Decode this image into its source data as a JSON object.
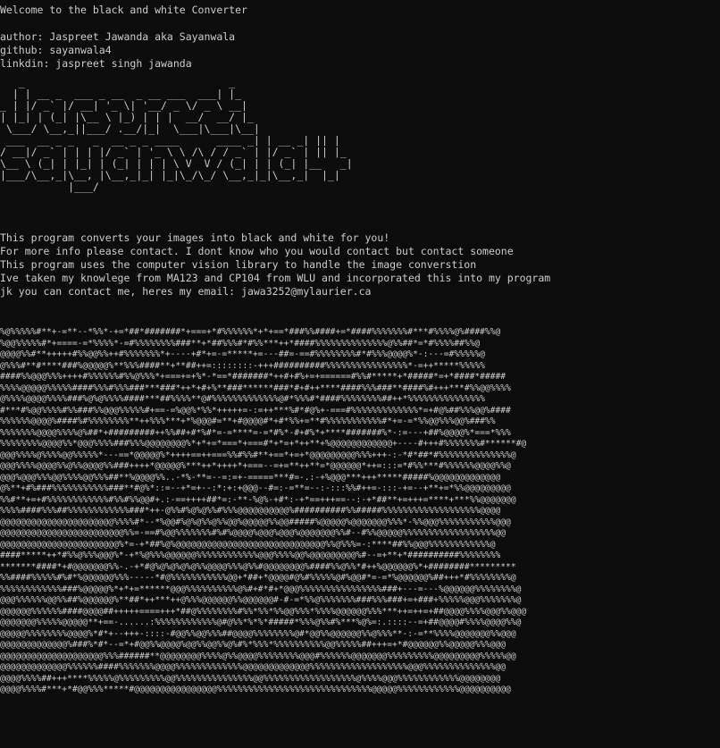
{
  "terminal": {
    "welcome": "Welcome to the black and white Converter",
    "author": "author: Jaspreet Jawanda aka Sayanwala",
    "github": "github: sayanwala4",
    "linkedin": "linkdin: jaspreet singh jawanda"
  },
  "banner": {
    "name1": "Jaspreet",
    "name2": "sayanwala4",
    "lines": [
      "   _                                 _",
      "  | | __ _  ___ _ __  _ __ ___  ___| |_",
      "_ | |/ _` |/ __| '_ \\| '__/ _ \\/ _ \\ __|",
      "| |_| | (_| |\\__ \\ |_) | | |  __/  __/ |_",
      " \\___/ \\__,_||___/ .__/|_|  \\___|\\___|\\__|",
      " ___  __ _ _   _  __ _ _ ____      ____ _| | __ _| || |",
      "/ __|/ _` | | | |/ _` | '_ \\ \\ /\\ / / _` | |/ _` | || |_",
      "\\__ \\ (_| | |_| | (_| | | | \\ V  V / (_| | | (_| |__   _|",
      "|___/\\__,_|\\__, |\\__,_|_| |_|\\_/\\_/ \\__,_|_|\\__,_|  |_|",
      "           |___/"
    ]
  },
  "info": {
    "line1": "This program converts your images into black and white for you!",
    "line2": "For more info please contact. I dont know who you would contact but contact someone",
    "line3": "This program uses the computer vision library to handle the image converstion",
    "line4": "Ive taken my knowlege from MA123 and CP104 from WLU and incorporated this into my program",
    "line5": "jk you can contact me, heres my email: jawa3252@mylaurier.ca"
  },
  "ascii_output": [
    "%@%%%%%#**+-=**--*%%*-+=*##*#######*+===+*#%%%%%%*+*+==*###%%####+=*####%%%%%%%#***#%%%%@%####%%@",
    "%@@%%%%%#*+====-=*%%%%*-=#%%%%%%%%###**+*##%%%#*#%%***++*####%%%%%%%%%%%%%%@%%##*=*#%%%%##%%@",
    "@@@@%%#**+++++#%%@@%%++#%%%%%%%*+----+#*+=-=*****+=---##=-==#%%%%%%%%#*#%%%@@@@%*-:---=#%%%%%@",
    "@%%%#**#****###%@@@@@%**%%%####**+**##++=::::::::-+++##########%%%%%%%%%%%%%%%%*-=++*****%%%%%",
    "####%%@@@%%%++++#%%%%%%#%%@%%%*+===+=+%*-*==*#######*++#+#%+=+======#%%#*****+*#####*=+*####*#####",
    "%%%%@@@@@%%%%%####%%%#%%%###***###*++*+#+%**###******###*#+#++****####%%%###**####%#+++***#%%@@%%%%",
    "@%%%%@@@@%%%%###%@%@%%%%####***##%%%%**@#%%%%%%%%%%%%%@#*%%%#*####%%%%%%%%##++*%%%%%%%%%%%%%%%",
    "#***#%@@%%%%#%%###%%@@@%%%%%#+==-=%@@%*%%*+++++=-:=++***%#*#@%+-===#%%%%%%%%%%%%%*=+#@%##%%%@@%####",
    "%%%%%%@@@@%####%#%%%%%%%%**++%%%***+*%@@@#=**+#@@@@#*+#*%%+=**#%%%%%%%%%%%#*+=-=*%%@@%%%@@%###%%",
    "%%%%%%%@@@@%%%%@%##*+#########++%%##+#*%#*=-=****=-=*#%*-#+#%*+****#######%*-:=---+##%@@@@%*===*%%%",
    "%%%%%%%%@@@@%%*@@@%%%%###%%%@@@@@@@@%*+*+=*===*+===#*+*=+*++**+%@@@@@@@@@@@@+----#+++#%%%%%%%#******#@",
    "@@@%%%%@%%%%@@%%%%%*---==*@@@@@%*++++==++===%%#%%#**+==*+=+*@@@@@@@@@%%%+++-:-*#*##*#%%%%%%%%%%%%%%@",
    "@@@%%%%@@@@%%@%%@@@@%%###++++*@@@@@%***++*++++*+===--=+=**++**=*@@@@@@*++=:::=*#%%***#%%%%%%@@@@%%@",
    "@@@%@@@%%%@@%%%%@@%%%##**%@@@@%%..-*%-**=--=:=+-=====***#=-.:-+%@@@***+++*****#####%@@@@@@@@@@@@@",
    "@%**+#%###%%%%%%%%%%%###**#@%*::=--+*=+--:*:+:+@@@--#=:-=**=--:-:::%%#++=-:::-+=--+**+=*%%@@@@@@@@@",
    "%%#**+=+#%%%%%%%%%%%%#%%#%%@@#+.:-==++++##*=:-**-%@%-+#*:-+*==+++==--:-+*##**+=+++=****+***%%@@@@@@@",
    "%%%%####%%%##%%%%%%%%%%%%###*++-@%%#%@%@%%#%%%@@@@@@@@@@%##########%%#####%%%%%%%%%%%%%%%%%%%@@@@",
    "@@@@@@@@@@@@@@@@@@@@@@%%%%#*--*%@@#%@%@%%@%%@@%@@@@@%%@@#####%@@@@@%@@@@@@@%%%*-%%@@@%%%%%%%%%%%@@@",
    "@@@@@@@@@@@@@@@@@@@@@@@@%%=-==#%@@%%%%%%%#%#%@@@@%@@@%@@@%@@@@@@@%%#--#%%@@@@@%%%%%%%%%%%%%%%%%%@@",
    "@@@@@@@@@@@@@@@@@@@@@@@%*=-+*##%@%@@@@@@@@@@@@@@@@@@@@@@@@@@@@@%%@%%%=-:****##%%@@@%%%%%%%%%%%%@",
    "####*****++*#%%@%%%@@@%*-+*%@%%%@@@@@@%%%%%%%%%%%%@@@%%%%@@%@@@@@@@@@%#--=+**+*##########%%%%%%%%",
    "*******####*+#@@@@@@@%%-.-+*#@%@%@%@%@%%@@@@%%%@%%#@@@@@@@@%####%%@%%*#++%@@@@@@%*+########*********",
    "%%####%%%%%#%#*%@@@@@@%%%-----*#@%%%%%%%%%%%@@+*##+*@@@@#@%#%%%%%@#%@@#*=-=*%@@@@@@%##+++*#%%%%%%%%@",
    "%%%%%%%%%%%%###%@@@@@%*+*+=******@@@%%%%%%%%%%@%#+#*#+*@@@%%%%%%%%%%%%%%%%###+---=---%@@@@@@%%%%%%%%@",
    "@@@%%%%%%@@%%##%@@@@@@%**##*++***++@%%%@@@@@@%%@@@@@@#-#-=*%%@%%%%%%%###%%%###+=+###+%%%%%@@@%%%%%%%@",
    "@@@@@@%%%%%%####@@@@##+++++====+++*##@%%%%%%%%#%%*%%*%%@@%%%*%%%%@@@@@@%%%***++=++=+##@@@@%%%%@@@%%@@@",
    "@@@@@@@%%%%%@@@@@**+==-......:%%%%%%%%%%%%@#@%%*%*%*#####*%%%@%%#%***%@%=:.::::--=+##@@@@#%%%%@@@@%%@",
    "@@@@@%%%%%%%%@@@@%*#*+--+++-::::-#@@%%@@%%%##@@@@%%%%%%%%@#*@@%%@@@@@@%%@%%%**-:-=**%%%%@@@@@@@%%@@@",
    "@@@@@@@@@@@@@%###%*#*--=*+#@@%%@@@@%@@%%@@%%@%#%*%%%*%%%%%%%%%%@@%%%%%##+++=+*#@@@@@@%%@@@@@%%%@@@",
    "@@@@@@@@@@@@@@@@@@@@%%%######**@@@@@@@@%%%%@%%@@@@%%%%%%%%@@@#%%%%%%@@@@@@@%%%%%%%%%@@@@@@@@@%%%%%@@",
    "@@@@@@@@@@@@@%%%%%%####%%%%%%%@@@@%%%%%%%%%%%%%@@@@@@@@@@@@@%%%%%%%%%%%%%%%%%%%@@@%%%%%%%%%%%%%%@@",
    "@@@@%%%%##+++****%%%%%@%%%%%%%%%@@%%%%%%%%%%%%%%%@@%%%%%%%%%%%%%%%%%%@%%%%@@@%%%%%%%%%%%%@@@@@@@@",
    "@@@@%%%%#***+*#@@%%%*****#@@@@@@@@@@@@@@@@%%%%%%%%%%%%%%%%%%%%%%%%%%%%%%@@@@@%%%%%%%%%%%%@@@@@@@@@@"
  ]
}
